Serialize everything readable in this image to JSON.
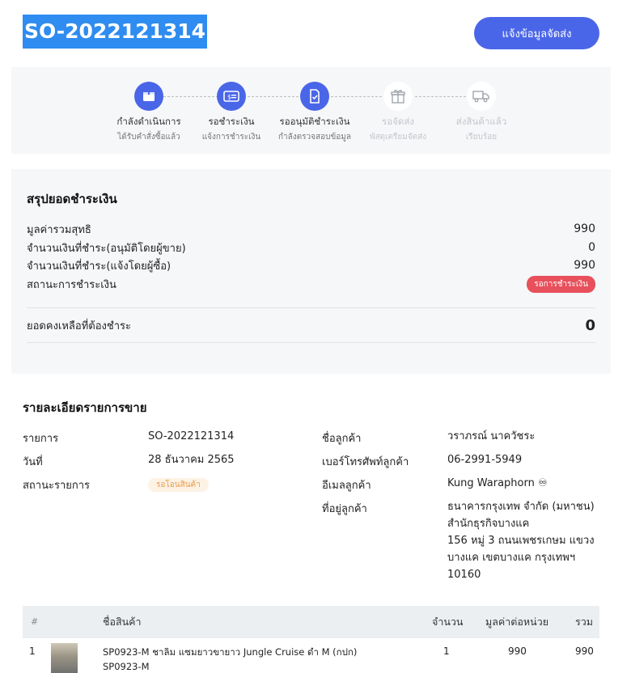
{
  "header": {
    "order_id": "SO-2022121314",
    "notify_button": "แจ้งข้อมูลจัดส่ง"
  },
  "stepper": [
    {
      "title": "กำลังดำเนินการ",
      "subtitle": "ได้รับคำสั่งซื้อแล้ว",
      "state": "active",
      "icon": "box-icon"
    },
    {
      "title": "รอชำระเงิน",
      "subtitle": "แจ้งการชำระเงิน",
      "state": "active",
      "icon": "payment-card-icon"
    },
    {
      "title": "รออนุมัติชำระเงิน",
      "subtitle": "กำลังตรวจสอบข้อมูล",
      "state": "active",
      "icon": "document-check-icon"
    },
    {
      "title": "รอจัดส่ง",
      "subtitle": "พัสดุเตรียมจัดส่ง",
      "state": "inactive",
      "icon": "gift-icon"
    },
    {
      "title": "ส่งสินค้าแล้ว",
      "subtitle": "เรียบร้อย",
      "state": "inactive",
      "icon": "truck-icon"
    }
  ],
  "summary": {
    "title": "สรุปยอดชำระเงิน",
    "net_total_label": "มูลค่ารวมสุทธิ",
    "net_total_value": "990",
    "paid_seller_label": "จำนวนเงินที่ชำระ(อนุมัติโดยผู้ขาย)",
    "paid_seller_value": "0",
    "paid_buyer_label": "จำนวนเงินที่ชำระ(แจ้งโดยผู้ซื้อ)",
    "paid_buyer_value": "990",
    "status_label": "สถานะการชำระเงิน",
    "status_badge": "รอการชำระเงิน",
    "balance_label": "ยอดคงเหลือที่ต้องชำระ",
    "balance_value": "0"
  },
  "details": {
    "title": "รายละเอียดรายการขาย",
    "item_label": "รายการ",
    "item_value": "SO-2022121314",
    "date_label": "วันที่",
    "date_value": "28 ธันวาคม 2565",
    "status_label": "สถานะรายการ",
    "status_badge": "รอโอนสินค้า",
    "customer_name_label": "ชื่อลูกค้า",
    "customer_name_value": "วราภรณ์ นาควัชระ",
    "phone_label": "เบอร์โทรศัพท์ลูกค้า",
    "phone_value": "06-2991-5949",
    "email_label": "อีเมลลูกค้า",
    "email_value": "Kung Waraphorn ♾",
    "address_label": "ที่อยู่ลูกค้า",
    "address_lines": [
      "ธนาคารกรุงเทพ จำกัด (มหาชน)",
      "สำนักธุรกิจบางแค",
      "156 หมู่ 3 ถนนเพชรเกษม แขวง",
      "บางแค เขตบางแค กรุงเทพฯ",
      "10160"
    ]
  },
  "table": {
    "headers": {
      "index": "#",
      "name": "ชื่อสินค้า",
      "qty": "จำนวน",
      "unit_price": "มูลค่าต่อหน่วย",
      "total": "รวม"
    },
    "rows": [
      {
        "index": "1",
        "name": "SP0923-M ชาลิม แซมยาวขายาว Jungle Cruise ดำ M (กปก)",
        "sku": "SP0923-M",
        "qty": "1",
        "unit_price": "990",
        "total": "990"
      }
    ]
  },
  "colors": {
    "primary": "#4a66e8",
    "danger": "#e8505b",
    "warning_bg": "#fdf2e4",
    "warning_text": "#e89a4a",
    "panel_bg": "#f6f7f9"
  }
}
